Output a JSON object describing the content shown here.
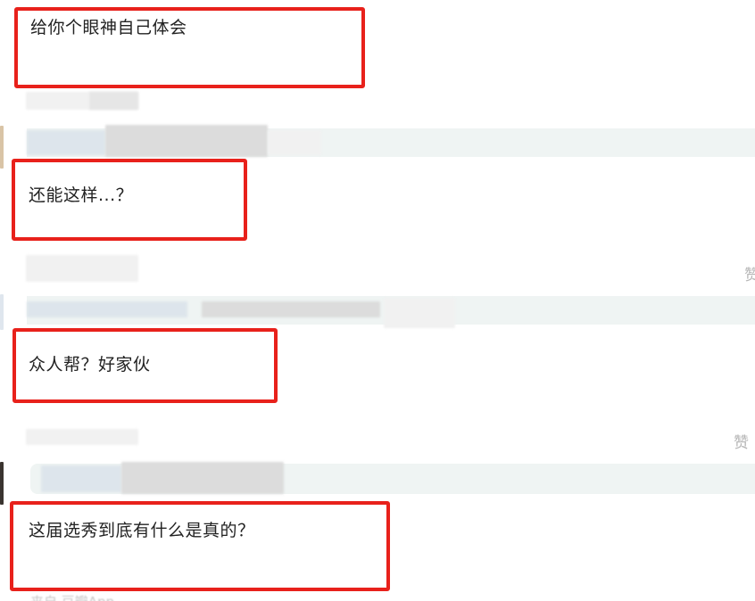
{
  "comments": [
    {
      "text": "给你个眼神自己体会"
    },
    {
      "text": "还能这样...？"
    },
    {
      "text": "众人帮？好家伙"
    },
    {
      "text": "这届选秀到底有什么是真的？"
    }
  ],
  "likes": [
    {
      "label": "赞"
    },
    {
      "label": "赞"
    }
  ],
  "footer": {
    "source": "来自 豆瓣App"
  },
  "colors": {
    "highlight_border": "#e8211b",
    "reply_strip": "#eff4f3",
    "blur_placeholder": "#eeeeee"
  }
}
